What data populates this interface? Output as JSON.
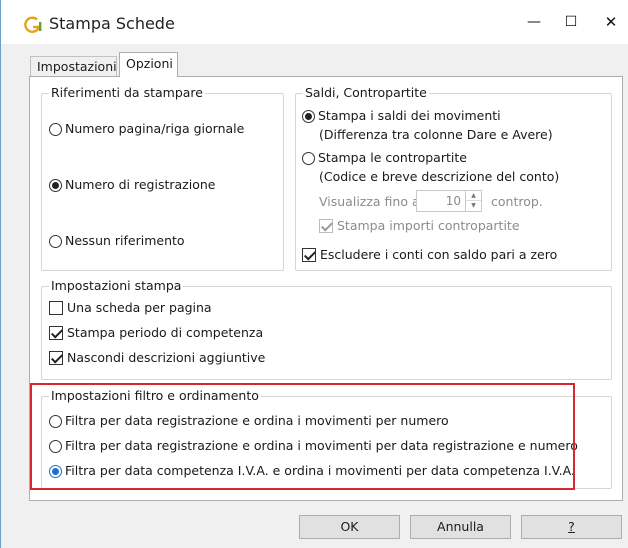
{
  "window": {
    "title": "Stampa Schede",
    "icon": "g-logo-icon",
    "controls": {
      "minimize": "—",
      "maximize": "☐",
      "close": "✕"
    }
  },
  "tabs": [
    {
      "label": "Impostazioni",
      "active": false
    },
    {
      "label": "Opzioni",
      "active": true
    }
  ],
  "riferimenti": {
    "title": "Riferimenti da stampare",
    "options": [
      {
        "label": "Numero pagina/riga giornale",
        "selected": false
      },
      {
        "label": "Numero di registrazione",
        "selected": true
      },
      {
        "label": "Nessun riferimento",
        "selected": false
      }
    ]
  },
  "saldi": {
    "title": "Saldi, Contropartite",
    "stampa_saldi": {
      "label": "Stampa i saldi dei movimenti",
      "sub": "(Differenza tra colonne Dare e Avere)",
      "selected": true
    },
    "stampa_contropartite": {
      "label": "Stampa le contropartite",
      "sub": "(Codice e breve descrizione del conto)",
      "selected": false
    },
    "visualizza": {
      "label": "Visualizza fino a",
      "value": "10",
      "suffix": "controp."
    },
    "stampa_importi": {
      "label": "Stampa importi contropartite",
      "checked": true,
      "enabled": false
    },
    "escludere": {
      "label": "Escludere i conti con saldo pari a zero",
      "checked": true
    }
  },
  "impostazioni_stampa": {
    "title": "Impostazioni stampa",
    "options": [
      {
        "label": "Una scheda per pagina",
        "checked": false
      },
      {
        "label": "Stampa periodo di competenza",
        "checked": true
      },
      {
        "label": "Nascondi descrizioni aggiuntive",
        "checked": true
      }
    ]
  },
  "filtro": {
    "title": "Impostazioni filtro e ordinamento",
    "options": [
      {
        "label": "Filtra per data registrazione e ordina i movimenti per numero",
        "selected": false
      },
      {
        "label": "Filtra per data registrazione e ordina i movimenti per data registrazione e numero",
        "selected": false
      },
      {
        "label": "Filtra per data competenza I.V.A. e ordina i movimenti per data competenza I.V.A.",
        "selected": true
      }
    ]
  },
  "buttons": {
    "ok": "OK",
    "annulla": "Annulla",
    "help": "?"
  },
  "colors": {
    "highlight": "#d8282f",
    "accent": "#1f6fc5",
    "border": "#6aa0cc"
  }
}
